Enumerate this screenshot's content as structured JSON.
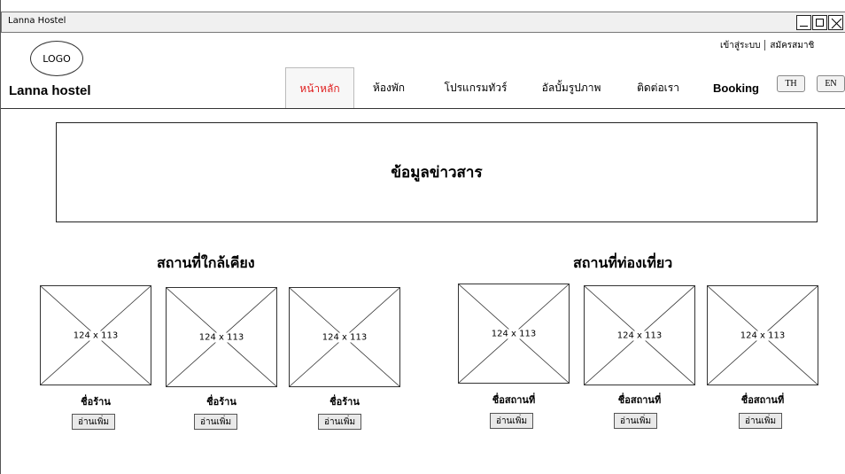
{
  "window": {
    "title": "Lanna Hostel"
  },
  "header": {
    "logo_text": "LOGO",
    "brand": "Lanna hostel",
    "auth": {
      "login": "เข้าสู่ระบบ",
      "register": "สมัครสมาชิ"
    }
  },
  "nav": {
    "items": [
      {
        "label": "หน้าหลัก",
        "active": true
      },
      {
        "label": "ห้องพัก"
      },
      {
        "label": "โปรแกรมทัวร์"
      },
      {
        "label": "อัลบั้มรูปภาพ"
      },
      {
        "label": "ติดต่อเรา"
      },
      {
        "label": "Booking"
      }
    ],
    "active_color": "#e02020",
    "languages": [
      "TH",
      "EN"
    ]
  },
  "news": {
    "title": "ข้อมูลข่าวสาร"
  },
  "nearby": {
    "title": "สถานที่ใกล้เคียง",
    "cards": [
      {
        "image_label": "124 x 113",
        "name": "ชื่อร้าน",
        "button": "อ่านเพิ่ม"
      },
      {
        "image_label": "124 x 113",
        "name": "ชื่อร้าน",
        "button": "อ่านเพิ่ม"
      },
      {
        "image_label": "124 x 113",
        "name": "ชื่อร้าน",
        "button": "อ่านเพิ่ม"
      }
    ]
  },
  "attractions": {
    "title": "สถานที่ท่องเที่ยว",
    "cards": [
      {
        "image_label": "124 x 113",
        "name": "ชื่อสถานที่",
        "button": "อ่านเพิ่ม"
      },
      {
        "image_label": "124 x 113",
        "name": "ชื่อสถานที่",
        "button": "อ่านเพิ่ม"
      },
      {
        "image_label": "124 x 113",
        "name": "ชื่อสถานที่",
        "button": "อ่านเพิ่ม"
      }
    ]
  }
}
